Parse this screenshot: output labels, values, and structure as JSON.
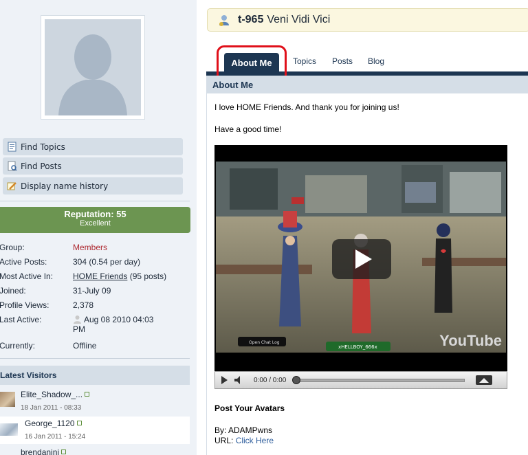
{
  "sidebar": {
    "buttons": [
      {
        "label": "Find Topics",
        "icon": "page-icon"
      },
      {
        "label": "Find Posts",
        "icon": "search-page-icon"
      },
      {
        "label": "Display name history",
        "icon": "edit-icon"
      }
    ],
    "reputation": {
      "title": "Reputation: 55",
      "level": "Excellent",
      "color": "#6c9551"
    },
    "info": {
      "group_label": "Group:",
      "group_value": "Members",
      "posts_label": "Active Posts:",
      "posts_value": "304 (0.54 per day)",
      "active_label": "Most Active In:",
      "active_link": "HOME Friends",
      "active_count": "(95 posts)",
      "joined_label": "Joined:",
      "joined_value": "31-July 09",
      "views_label": "Profile Views:",
      "views_value": "2,378",
      "last_label": "Last Active:",
      "last_value_1": "Aug 08 2010 04:03",
      "last_value_2": "PM",
      "currently_label": "Currently:",
      "currently_value": "Offline"
    },
    "visitors_title": "Latest Visitors",
    "visitors": [
      {
        "name": "Elite_Shadow_...",
        "date": "18 Jan 2011 - 08:33"
      },
      {
        "name": "George_1120",
        "date": "16 Jan 2011 - 15:24"
      },
      {
        "name": "brendanini",
        "date": ""
      }
    ]
  },
  "header": {
    "user_id": "t-965",
    "title": "Veni Vidi Vici"
  },
  "tabs": [
    {
      "label": "About Me"
    },
    {
      "label": "Topics"
    },
    {
      "label": "Posts"
    },
    {
      "label": "Blog"
    }
  ],
  "about": {
    "heading": "About Me",
    "line1": "I love HOME Friends. And thank you for joining us!",
    "line2": "Have a good time!",
    "video": {
      "time": "0:00 / 0:00",
      "brand": "YouTube",
      "chip": "xHELLBOY_666x",
      "chat": "Open Chat Log"
    },
    "post_title": "Post Your Avatars",
    "by_label": "By: ADAMPwns",
    "url_label": "URL:",
    "url_link": "Click Here"
  },
  "colors": {
    "accent": "#1d3652",
    "highlight": "#e0101a",
    "group": "#ad2930"
  }
}
